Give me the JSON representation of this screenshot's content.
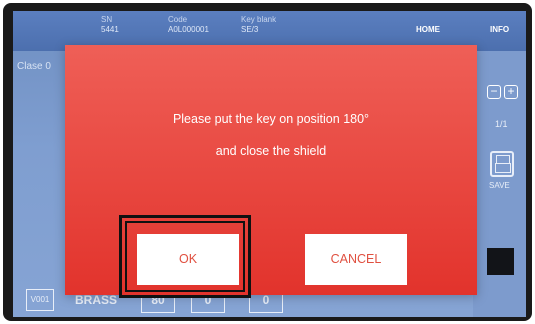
{
  "header": {
    "col1_label": "SN",
    "col1_value": "5441",
    "col2_label": "Code",
    "col2_value": "A0L000001",
    "col3_label": "Key blank",
    "col3_value": "SE/3",
    "home_label": "HOME",
    "info_label": "INFO"
  },
  "background": {
    "sub_label": "Clase 0"
  },
  "side": {
    "minus": "−",
    "plus": "+",
    "pager": "1/1",
    "save_label": "SAVE"
  },
  "bottom": {
    "badge": "V001",
    "material": "BRASS",
    "pos1": "80",
    "pos2": "0",
    "pos3": "0"
  },
  "dialog": {
    "line1": "Please put the key on position 180°",
    "line2": "and close the shield",
    "ok_label": "OK",
    "cancel_label": "CANCEL"
  },
  "colors": {
    "dialog_red": "#e2332c",
    "button_text": "#e05040",
    "screen_blue": "#7f9ed0"
  }
}
